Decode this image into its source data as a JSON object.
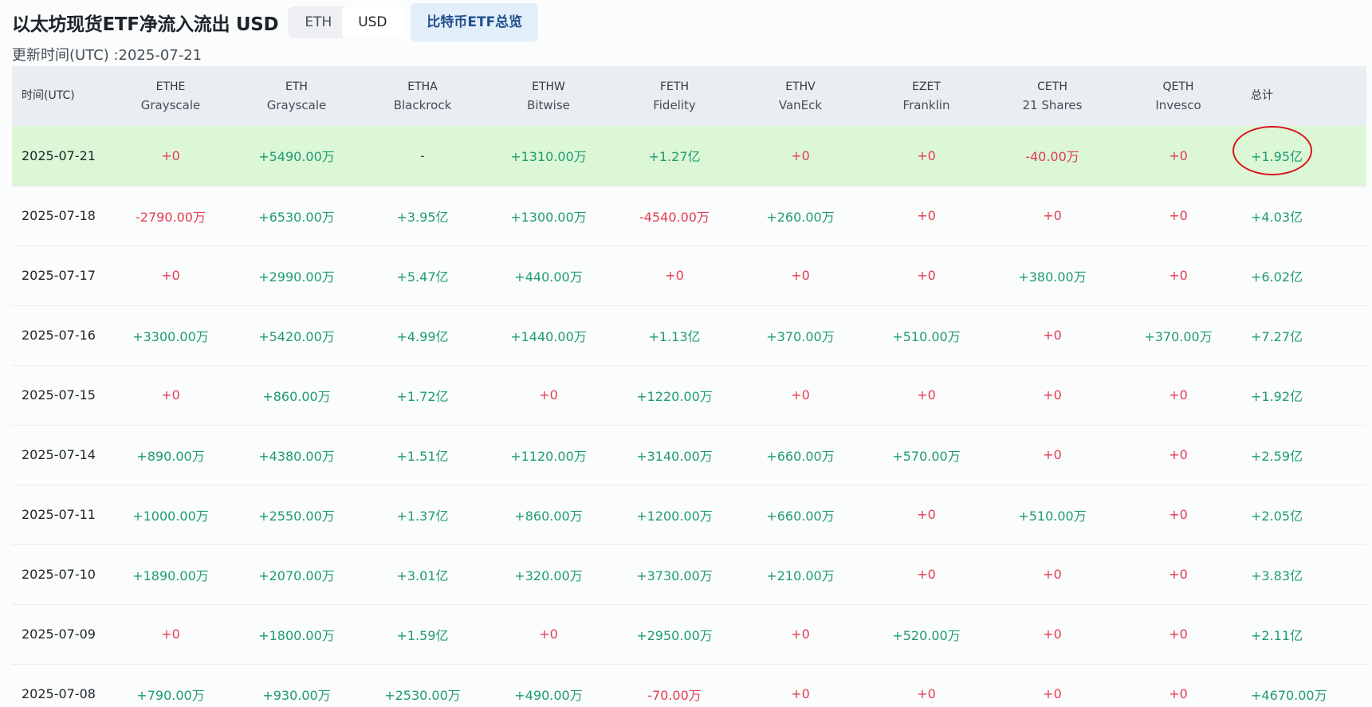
{
  "title": "以太坊现货ETF净流入流出 USD",
  "unit_toggle": {
    "options": [
      "ETH",
      "USD"
    ],
    "selected": "USD"
  },
  "btc_overview_label": "比特币ETF总览",
  "updated_text": "更新时间(UTC) :2025-07-21",
  "table": {
    "headers": [
      {
        "ticker": "时间(UTC)",
        "issuer": ""
      },
      {
        "ticker": "ETHE",
        "issuer": "Grayscale"
      },
      {
        "ticker": "ETH",
        "issuer": "Grayscale"
      },
      {
        "ticker": "ETHA",
        "issuer": "Blackrock"
      },
      {
        "ticker": "ETHW",
        "issuer": "Bitwise"
      },
      {
        "ticker": "FETH",
        "issuer": "Fidelity"
      },
      {
        "ticker": "ETHV",
        "issuer": "VanEck"
      },
      {
        "ticker": "EZET",
        "issuer": "Franklin"
      },
      {
        "ticker": "CETH",
        "issuer": "21 Shares"
      },
      {
        "ticker": "QETH",
        "issuer": "Invesco"
      },
      {
        "ticker": "总计",
        "issuer": ""
      }
    ],
    "rows": [
      {
        "date": "2025-07-21",
        "cells": [
          "+0",
          "+5490.00万",
          "-",
          "+1310.00万",
          "+1.27亿",
          "+0",
          "+0",
          "-40.00万",
          "+0"
        ],
        "total": "+1.95亿"
      },
      {
        "date": "2025-07-18",
        "cells": [
          "-2790.00万",
          "+6530.00万",
          "+3.95亿",
          "+1300.00万",
          "-4540.00万",
          "+260.00万",
          "+0",
          "+0",
          "+0"
        ],
        "total": "+4.03亿"
      },
      {
        "date": "2025-07-17",
        "cells": [
          "+0",
          "+2990.00万",
          "+5.47亿",
          "+440.00万",
          "+0",
          "+0",
          "+0",
          "+380.00万",
          "+0"
        ],
        "total": "+6.02亿"
      },
      {
        "date": "2025-07-16",
        "cells": [
          "+3300.00万",
          "+5420.00万",
          "+4.99亿",
          "+1440.00万",
          "+1.13亿",
          "+370.00万",
          "+510.00万",
          "+0",
          "+370.00万"
        ],
        "total": "+7.27亿"
      },
      {
        "date": "2025-07-15",
        "cells": [
          "+0",
          "+860.00万",
          "+1.72亿",
          "+0",
          "+1220.00万",
          "+0",
          "+0",
          "+0",
          "+0"
        ],
        "total": "+1.92亿"
      },
      {
        "date": "2025-07-14",
        "cells": [
          "+890.00万",
          "+4380.00万",
          "+1.51亿",
          "+1120.00万",
          "+3140.00万",
          "+660.00万",
          "+570.00万",
          "+0",
          "+0"
        ],
        "total": "+2.59亿"
      },
      {
        "date": "2025-07-11",
        "cells": [
          "+1000.00万",
          "+2550.00万",
          "+1.37亿",
          "+860.00万",
          "+1200.00万",
          "+660.00万",
          "+0",
          "+510.00万",
          "+0"
        ],
        "total": "+2.05亿"
      },
      {
        "date": "2025-07-10",
        "cells": [
          "+1890.00万",
          "+2070.00万",
          "+3.01亿",
          "+320.00万",
          "+3730.00万",
          "+210.00万",
          "+0",
          "+0",
          "+0"
        ],
        "total": "+3.83亿"
      },
      {
        "date": "2025-07-09",
        "cells": [
          "+0",
          "+1800.00万",
          "+1.59亿",
          "+0",
          "+2950.00万",
          "+0",
          "+520.00万",
          "+0",
          "+0"
        ],
        "total": "+2.11亿"
      },
      {
        "date": "2025-07-08",
        "cells": [
          "+790.00万",
          "+930.00万",
          "+2530.00万",
          "+490.00万",
          "-70.00万",
          "+0",
          "+0",
          "+0",
          "+0"
        ],
        "total": "+4670.00万"
      }
    ]
  },
  "colors": {
    "positive": "#1e9b73",
    "negative": "#e33b52",
    "highlight_row": "#dbf7d5",
    "annotation_circle": "#d9141e"
  }
}
